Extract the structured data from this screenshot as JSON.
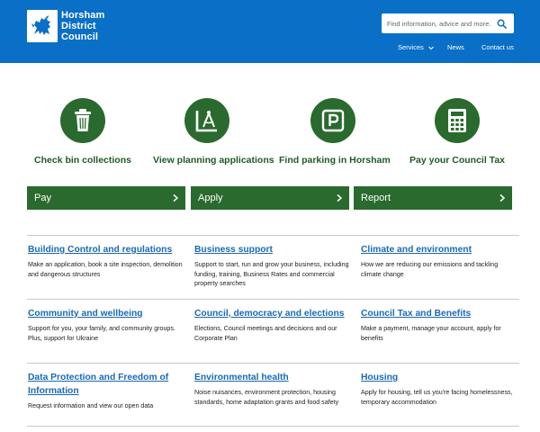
{
  "header": {
    "logo_lines": [
      "Horsham",
      "District",
      "Council"
    ],
    "search_placeholder": "Find information, advice and more...",
    "nav": [
      {
        "label": "Services",
        "has_dropdown": true
      },
      {
        "label": "News"
      },
      {
        "label": "Contact us"
      }
    ],
    "bg_color": "#0a6fc6"
  },
  "quick_links": [
    {
      "label": "Check bin collections",
      "icon": "bin-icon"
    },
    {
      "label": "View planning applications",
      "icon": "compass-set-square-icon"
    },
    {
      "label": "Find parking in Horsham",
      "icon": "parking-sign-icon"
    },
    {
      "label": "Pay your Council Tax",
      "icon": "calculator-icon"
    }
  ],
  "actions": [
    {
      "label": "Pay"
    },
    {
      "label": "Apply"
    },
    {
      "label": "Report"
    }
  ],
  "services": [
    {
      "title": "Building Control and regulations",
      "description": "Make an application, book a site inspection, demolition and dangerous structures"
    },
    {
      "title": "Business support",
      "description": "Support to start, run and grow your business, including funding, training, Business Rates and commercial property searches"
    },
    {
      "title": "Climate and environment",
      "description": "How we are reducing our emissions and tackling climate change"
    },
    {
      "title": "Community and wellbeing",
      "description": "Support for you, your family, and community groups. Plus, support for Ukraine"
    },
    {
      "title": "Council, democracy and elections",
      "description": "Elections, Council meetings and decisions and our Corporate Plan"
    },
    {
      "title": "Council Tax and Benefits",
      "description": "Make a payment, manage your account, apply for benefits"
    },
    {
      "title": "Data Protection and Freedom of Information",
      "description": "Request information and view our open data"
    },
    {
      "title": "Environmental health",
      "description": "Noise nuisances, environment protection, housing standards, home adaptation grants and food safety"
    },
    {
      "title": "Housing",
      "description": "Apply for housing, tell us you're facing homelessness, temporary accommodation"
    }
  ],
  "colors": {
    "green": "#2a6a2e",
    "link_blue": "#1a69b5"
  }
}
